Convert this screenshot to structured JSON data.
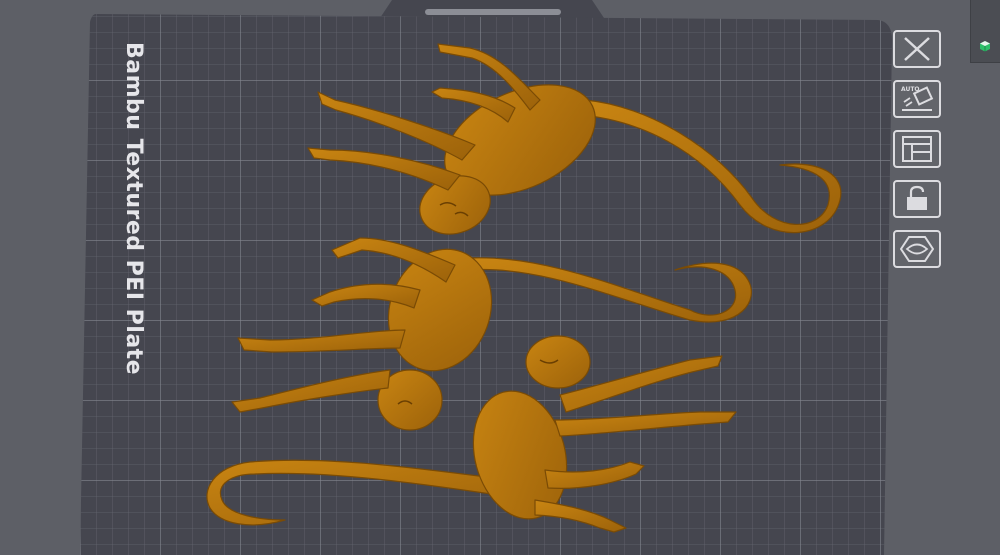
{
  "plate": {
    "label": "Bambu Textured PEI Plate"
  },
  "toolbar": {
    "buttons": [
      {
        "name": "close-plate-button",
        "icon": "close-icon"
      },
      {
        "name": "auto-orient-button",
        "icon": "auto-orient-icon",
        "text": "AUTO"
      },
      {
        "name": "arrange-button",
        "icon": "arrange-icon"
      },
      {
        "name": "lock-button",
        "icon": "unlock-icon"
      },
      {
        "name": "settings-button",
        "icon": "hexagon-eye-icon"
      }
    ]
  },
  "colors": {
    "background": "#5d5f66",
    "plate": "#45464f",
    "grid": "#7d8089",
    "model": "#b8760f",
    "model_shadow": "#8a5506",
    "icon": "#dcdce0"
  }
}
